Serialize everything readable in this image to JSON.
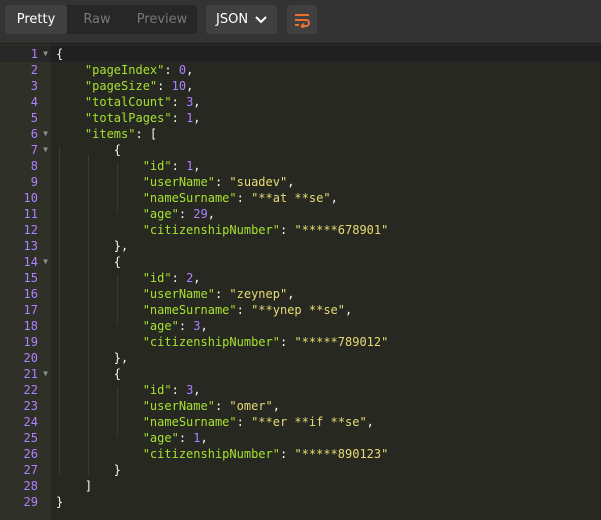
{
  "toolbar": {
    "view_tabs": [
      "Pretty",
      "Raw",
      "Preview"
    ],
    "active_view": "Pretty",
    "format": "JSON",
    "icons": {
      "format_dropdown": "chevron-down-icon",
      "wrap": "wrap-lines-icon"
    },
    "colors": {
      "wrap_icon": "#e8712f"
    }
  },
  "editor": {
    "line_numbers": [
      "1",
      "2",
      "3",
      "4",
      "5",
      "6",
      "7",
      "8",
      "9",
      "10",
      "11",
      "12",
      "13",
      "14",
      "15",
      "16",
      "17",
      "18",
      "19",
      "20",
      "21",
      "22",
      "23",
      "24",
      "25",
      "26",
      "27",
      "28",
      "29"
    ],
    "foldable_lines": [
      "1",
      "6",
      "7",
      "14",
      "21"
    ],
    "active_line": "1",
    "lines": [
      "{",
      "    \"pageIndex\": 0,",
      "    \"pageSize\": 10,",
      "    \"totalCount\": 3,",
      "    \"totalPages\": 1,",
      "    \"items\": [",
      "        {",
      "            \"id\": 1,",
      "            \"userName\": \"suadev\",",
      "            \"nameSurname\": \"**at **se\",",
      "            \"age\": 29,",
      "            \"citizenshipNumber\": \"*****678901\"",
      "        },",
      "        {",
      "            \"id\": 2,",
      "            \"userName\": \"zeynep\",",
      "            \"nameSurname\": \"**ynep **se\",",
      "            \"age\": 3,",
      "            \"citizenshipNumber\": \"*****789012\"",
      "        },",
      "        {",
      "            \"id\": 3,",
      "            \"userName\": \"omer\",",
      "            \"nameSurname\": \"**er **if **se\",",
      "            \"age\": 1,",
      "            \"citizenshipNumber\": \"*****890123\"",
      "        }",
      "    ]",
      "}"
    ],
    "colors": {
      "background": "#272822",
      "gutter": "#2f3129",
      "key": "#a6e22e",
      "string": "#e6db74",
      "number": "#ae81ff",
      "punctuation": "#f8f8f2"
    }
  }
}
